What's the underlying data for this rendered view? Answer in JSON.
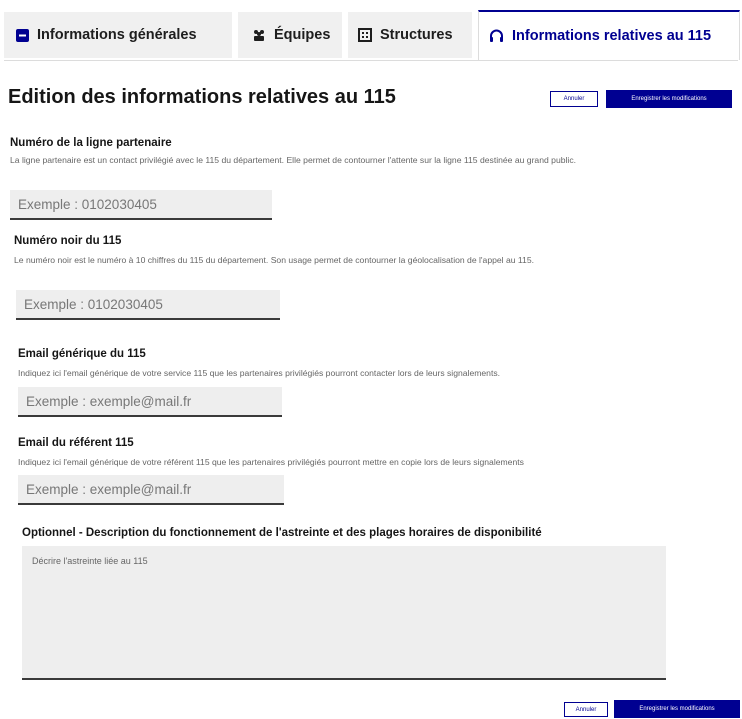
{
  "tabs": [
    {
      "label": "Informations générales",
      "icon": "info-square-icon",
      "active": false
    },
    {
      "label": "Équipes",
      "icon": "team-icon",
      "active": false
    },
    {
      "label": "Structures",
      "icon": "building-icon",
      "active": false
    },
    {
      "label": "Informations relatives au 115",
      "icon": "headset-icon",
      "active": true
    }
  ],
  "page": {
    "title": "Edition des informations relatives au 115",
    "cancel_label": "Annuler",
    "save_label": "Enregistrer les modifications"
  },
  "fields": {
    "partner_line": {
      "label": "Numéro de la ligne partenaire",
      "hint": "La ligne partenaire est un contact privilégié avec le 115 du département. Elle permet de contourner l'attente sur la ligne 115 destinée au grand public.",
      "placeholder": "Exemple : 0102030405",
      "value": ""
    },
    "black_number": {
      "label": "Numéro noir du 115",
      "hint": "Le numéro noir est le numéro à 10 chiffres du 115 du département. Son usage permet de contourner la géolocalisation de l'appel au 115.",
      "placeholder": "Exemple : 0102030405",
      "value": ""
    },
    "generic_email": {
      "label": "Email générique du 115",
      "hint": "Indiquez ici l'email générique de votre service 115 que les partenaires privilégiés pourront contacter lors de leurs signalements.",
      "placeholder": "Exemple : exemple@mail.fr",
      "value": ""
    },
    "referent_email": {
      "label": "Email du référent 115",
      "hint": "Indiquez ici l'email générique de votre référent 115 que les partenaires privilégiés pourront mettre en copie lors de leurs signalements",
      "placeholder": "Exemple : exemple@mail.fr",
      "value": ""
    },
    "description": {
      "label": "Optionnel - Description du fonctionnement de l'astreinte et des plages horaires de disponibilité",
      "placeholder": "Décrire l'astreinte liée au 115",
      "value": ""
    }
  },
  "footer": {
    "cancel_label": "Annuler",
    "save_label": "Enregistrer les modifications"
  },
  "colors": {
    "primary": "#000091",
    "field_bg": "#eeeeee",
    "tab_bg": "#f0f0f0"
  }
}
